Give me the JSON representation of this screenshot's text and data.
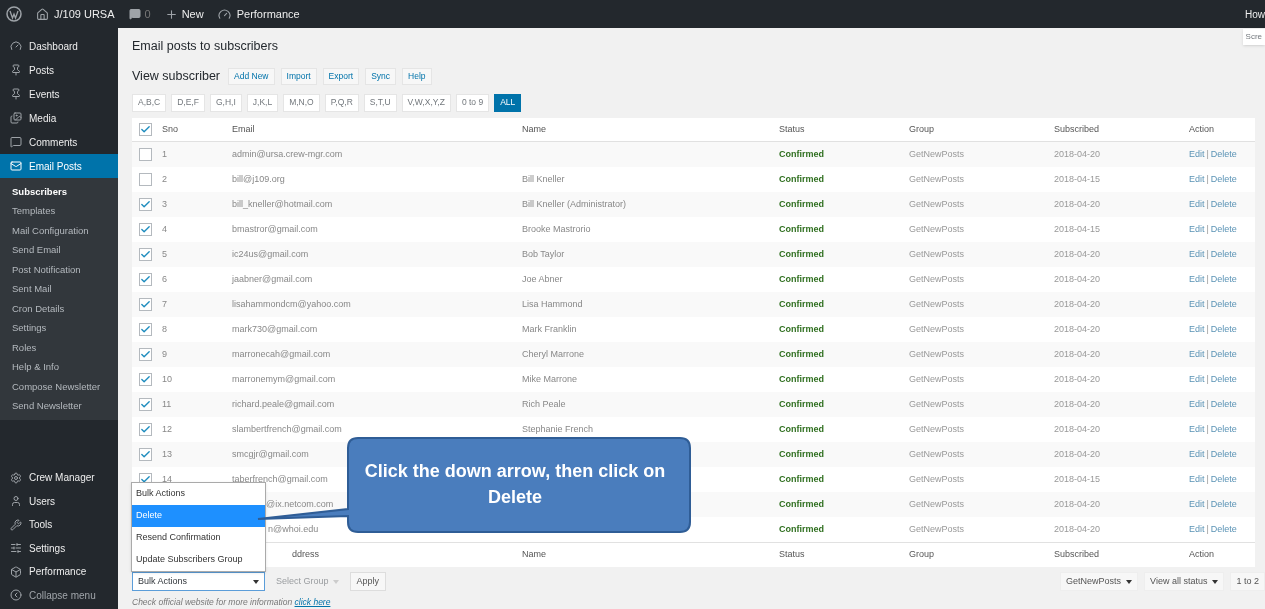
{
  "admin_bar": {
    "site": "J/109 URSA",
    "comments": "0",
    "new": "New",
    "performance": "Performance",
    "account": "How"
  },
  "screen_options": "Scre",
  "sidebar": {
    "items": [
      {
        "label": "Dashboard",
        "selected": false
      },
      {
        "label": "Posts",
        "selected": false
      },
      {
        "label": "Events",
        "selected": false
      },
      {
        "label": "Media",
        "selected": false
      },
      {
        "label": "Comments",
        "selected": false
      },
      {
        "label": "Email Posts",
        "selected": true
      }
    ],
    "submenu": [
      {
        "label": "Subscribers",
        "selected": true
      },
      {
        "label": "Templates",
        "selected": false
      },
      {
        "label": "Mail Configuration",
        "selected": false
      },
      {
        "label": "Send Email",
        "selected": false
      },
      {
        "label": "Post Notification",
        "selected": false
      },
      {
        "label": "Sent Mail",
        "selected": false
      },
      {
        "label": "Cron Details",
        "selected": false
      },
      {
        "label": "Settings",
        "selected": false
      },
      {
        "label": "Roles",
        "selected": false
      },
      {
        "label": "Help & Info",
        "selected": false
      },
      {
        "label": "Compose Newsletter",
        "selected": false
      },
      {
        "label": "Send Newsletter",
        "selected": false
      }
    ],
    "lower_items": [
      {
        "label": "Crew Manager",
        "selected": false
      },
      {
        "label": "Users",
        "selected": false
      },
      {
        "label": "Tools",
        "selected": false
      },
      {
        "label": "Settings",
        "selected": false
      },
      {
        "label": "Performance",
        "selected": false
      },
      {
        "label": "Collapse menu",
        "selected": false
      }
    ]
  },
  "page_title": "Email posts to subscribers",
  "subtitle": "View subscriber",
  "actions": [
    "Add New",
    "Import",
    "Export",
    "Sync",
    "Help"
  ],
  "filters": [
    {
      "label": "A,B,C",
      "selected": false
    },
    {
      "label": "D,E,F",
      "selected": false
    },
    {
      "label": "G,H,I",
      "selected": false
    },
    {
      "label": "J,K,L",
      "selected": false
    },
    {
      "label": "M,N,O",
      "selected": false
    },
    {
      "label": "P,Q,R",
      "selected": false
    },
    {
      "label": "S,T,U",
      "selected": false
    },
    {
      "label": "V,W,X,Y,Z",
      "selected": false
    },
    {
      "label": "0 to 9",
      "selected": false
    },
    {
      "label": "ALL",
      "selected": true
    }
  ],
  "table": {
    "header_checked": true,
    "columns": [
      "Sno",
      "Email",
      "Name",
      "Status",
      "Group",
      "Subscribed",
      "Action"
    ],
    "footer_columns": [
      "ddress",
      "Name",
      "Status",
      "Group",
      "Subscribed",
      "Action"
    ],
    "action_separator": "|",
    "rows": [
      {
        "kind": "full",
        "checked": false,
        "sno": "1",
        "email": "admin@ursa.crew-mgr.com",
        "status": "Confirmed",
        "group": "GetNewPosts",
        "subscribed": "2018-04-20",
        "edit": "Edit",
        "delete": "Delete"
      },
      {
        "kind": "full",
        "checked": false,
        "sno": "2",
        "email": "bill@j109.org",
        "name": "Bill Kneller",
        "status": "Confirmed",
        "group": "GetNewPosts",
        "subscribed": "2018-04-15",
        "edit": "Edit",
        "delete": "Delete"
      },
      {
        "kind": "full",
        "checked": true,
        "sno": "3",
        "email": "bill_kneller@hotmail.com",
        "name": "Bill Kneller (Administrator)",
        "status": "Confirmed",
        "group": "GetNewPosts",
        "subscribed": "2018-04-20",
        "edit": "Edit",
        "delete": "Delete"
      },
      {
        "kind": "full",
        "checked": true,
        "sno": "4",
        "email": "bmastror@gmail.com",
        "name": "Brooke Mastrorio",
        "status": "Confirmed",
        "group": "GetNewPosts",
        "subscribed": "2018-04-15",
        "edit": "Edit",
        "delete": "Delete"
      },
      {
        "kind": "full",
        "checked": true,
        "sno": "5",
        "email": "ic24us@gmail.com",
        "name": "Bob Taylor",
        "status": "Confirmed",
        "group": "GetNewPosts",
        "subscribed": "2018-04-20",
        "edit": "Edit",
        "delete": "Delete"
      },
      {
        "kind": "full",
        "checked": true,
        "sno": "6",
        "email": "jaabner@gmail.com",
        "name": "Joe Abner",
        "status": "Confirmed",
        "group": "GetNewPosts",
        "subscribed": "2018-04-20",
        "edit": "Edit",
        "delete": "Delete"
      },
      {
        "kind": "full",
        "checked": true,
        "sno": "7",
        "email": "lisahammondcm@yahoo.com",
        "name": "Lisa Hammond",
        "status": "Confirmed",
        "group": "GetNewPosts",
        "subscribed": "2018-04-20",
        "edit": "Edit",
        "delete": "Delete"
      },
      {
        "kind": "full",
        "checked": true,
        "sno": "8",
        "email": "mark730@gmail.com",
        "name": "Mark Franklin",
        "status": "Confirmed",
        "group": "GetNewPosts",
        "subscribed": "2018-04-20",
        "edit": "Edit",
        "delete": "Delete"
      },
      {
        "kind": "full",
        "checked": true,
        "sno": "9",
        "email": "marronecah@gmail.com",
        "name": "Cheryl Marrone",
        "status": "Confirmed",
        "group": "GetNewPosts",
        "subscribed": "2018-04-20",
        "edit": "Edit",
        "delete": "Delete"
      },
      {
        "kind": "full",
        "checked": true,
        "sno": "10",
        "email": "marronemym@gmail.com",
        "name": "Mike Marrone",
        "status": "Confirmed",
        "group": "GetNewPosts",
        "subscribed": "2018-04-20",
        "edit": "Edit",
        "delete": "Delete"
      },
      {
        "kind": "full",
        "checked": true,
        "sno": "11",
        "email": "richard.peale@gmail.com",
        "name": "Rich Peale",
        "status": "Confirmed",
        "group": "GetNewPosts",
        "subscribed": "2018-04-20",
        "edit": "Edit",
        "delete": "Delete"
      },
      {
        "kind": "full",
        "checked": true,
        "sno": "12",
        "email": "slambertfrench@gmail.com",
        "name": "Stephanie French",
        "status": "Confirmed",
        "group": "GetNewPosts",
        "subscribed": "2018-04-20",
        "edit": "Edit",
        "delete": "Delete"
      },
      {
        "kind": "full",
        "checked": true,
        "sno": "13",
        "email": "smcgjr@gmail.com",
        "status": "Confirmed",
        "group": "GetNewPosts",
        "subscribed": "2018-04-20",
        "edit": "Edit",
        "delete": "Delete"
      },
      {
        "kind": "full",
        "checked": true,
        "sno": "14",
        "email": "taberfrench@gmail.com",
        "status": "Confirmed",
        "group": "GetNewPosts",
        "subscribed": "2018-04-15",
        "edit": "Edit",
        "delete": "Delete"
      },
      {
        "kind": "partial",
        "email": "@ix.netcom.com",
        "status": "Confirmed",
        "group": "GetNewPosts",
        "subscribed": "2018-04-20",
        "edit": "Edit",
        "delete": "Delete"
      },
      {
        "kind": "partial",
        "email": "n@whoi.edu",
        "status": "Confirmed",
        "group": "GetNewPosts",
        "subscribed": "2018-04-20",
        "edit": "Edit",
        "delete": "Delete"
      }
    ]
  },
  "bulk_menu": [
    {
      "label": "Bulk Actions",
      "selected": false
    },
    {
      "label": "Delete",
      "selected": true
    },
    {
      "label": "Resend Confirmation",
      "selected": false
    },
    {
      "label": "Update Subscribers Group",
      "selected": false
    }
  ],
  "bulk_select": "Bulk Actions",
  "group_select": {
    "value": "Select Group",
    "disabled": true
  },
  "apply": "Apply",
  "group_filter": "GetNewPosts",
  "status_filter": "View all status",
  "pagination": "1 to 2",
  "footer_note": {
    "text": "Check official website for more information",
    "link": "click here"
  },
  "callout": "Click the down arrow, then click on Delete"
}
